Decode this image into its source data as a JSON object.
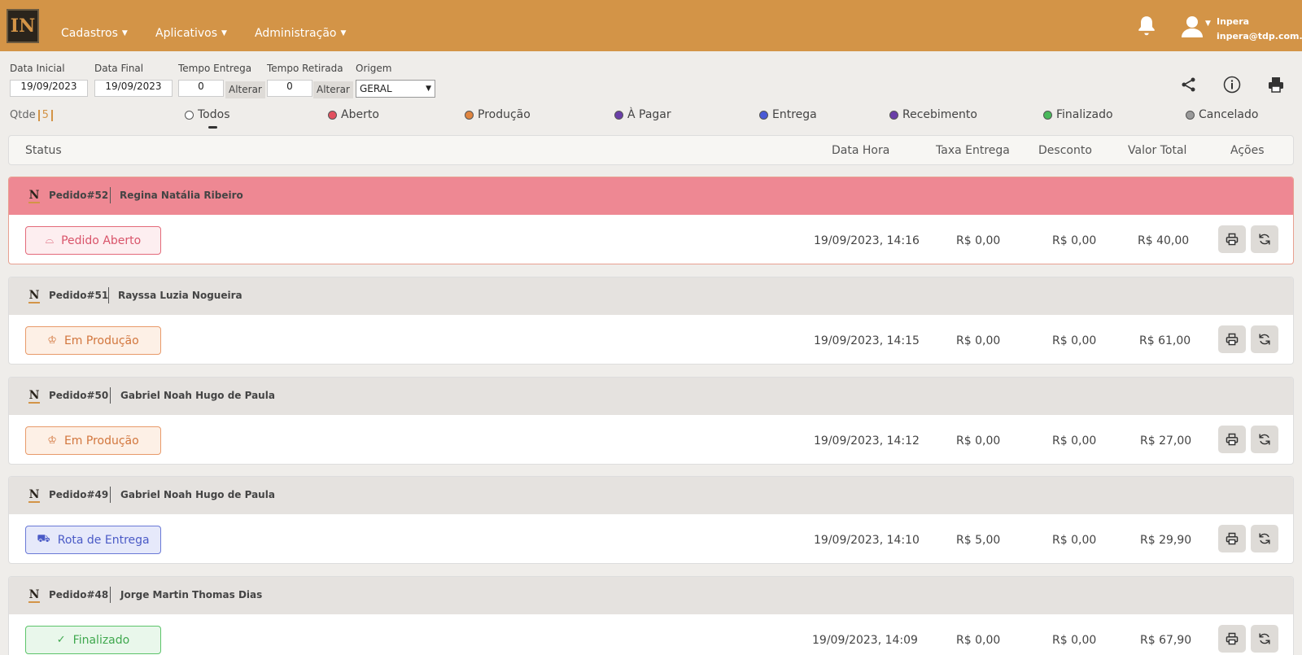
{
  "header": {
    "logo_text": "IN",
    "nav": [
      {
        "label": "Cadastros"
      },
      {
        "label": "Aplicativos"
      },
      {
        "label": "Administração"
      }
    ],
    "user": {
      "name": "Inpera",
      "email": "inpera@tdp.com.br"
    }
  },
  "filters": {
    "data_inicial_label": "Data Inicial",
    "data_inicial_value": "19/09/2023",
    "data_final_label": "Data Final",
    "data_final_value": "19/09/2023",
    "tempo_entrega_label": "Tempo Entrega",
    "tempo_entrega_value": "0",
    "tempo_retirada_label": "Tempo Retirada",
    "tempo_retirada_value": "0",
    "alterar_label": "Alterar",
    "origem_label": "Origem",
    "origem_value": "GERAL"
  },
  "summary": {
    "qtde_label": "Qtde",
    "qtde_value": "5"
  },
  "status_filters": [
    {
      "label": "Todos",
      "color": "#ffffff"
    },
    {
      "label": "Aberto",
      "color": "#e2505f"
    },
    {
      "label": "Produção",
      "color": "#e08540"
    },
    {
      "label": "À Pagar",
      "color": "#6a3fa8"
    },
    {
      "label": "Entrega",
      "color": "#4a5ad6"
    },
    {
      "label": "Recebimento",
      "color": "#6a3fa8"
    },
    {
      "label": "Finalizado",
      "color": "#49b85a"
    },
    {
      "label": "Cancelado",
      "color": "#9a9a9a"
    }
  ],
  "table_headers": {
    "status": "Status",
    "data_hora": "Data Hora",
    "taxa_entrega": "Taxa Entrega",
    "desconto": "Desconto",
    "valor_total": "Valor Total",
    "acoes": "Ações"
  },
  "orders": [
    {
      "pedido": "Pedido#52",
      "cliente": "Regina Natália Ribeiro",
      "status": "Pedido Aberto",
      "data_hora": "19/09/2023, 14:16",
      "taxa": "R$ 0,00",
      "desconto": "R$ 0,00",
      "total": "R$ 40,00"
    },
    {
      "pedido": "Pedido#51",
      "cliente": "Rayssa Luzia Nogueira",
      "status": "Em Produção",
      "data_hora": "19/09/2023, 14:15",
      "taxa": "R$ 0,00",
      "desconto": "R$ 0,00",
      "total": "R$ 61,00"
    },
    {
      "pedido": "Pedido#50",
      "cliente": "Gabriel Noah Hugo de Paula",
      "status": "Em Produção",
      "data_hora": "19/09/2023, 14:12",
      "taxa": "R$ 0,00",
      "desconto": "R$ 0,00",
      "total": "R$ 27,00"
    },
    {
      "pedido": "Pedido#49",
      "cliente": "Gabriel Noah Hugo de Paula",
      "status": "Rota de Entrega",
      "data_hora": "19/09/2023, 14:10",
      "taxa": "R$ 5,00",
      "desconto": "R$ 0,00",
      "total": "R$ 29,90"
    },
    {
      "pedido": "Pedido#48",
      "cliente": "Jorge Martin Thomas Dias",
      "status": "Finalizado",
      "data_hora": "19/09/2023, 14:09",
      "taxa": "R$ 0,00",
      "desconto": "R$ 0,00",
      "total": "R$ 67,90"
    }
  ]
}
